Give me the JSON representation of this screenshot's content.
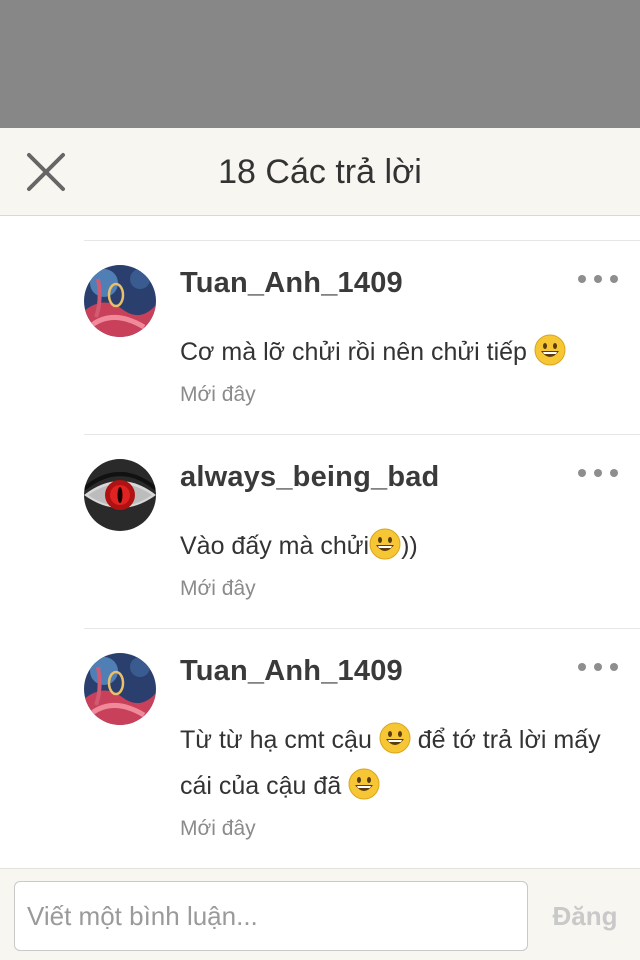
{
  "header": {
    "title": "18 Các trả lời"
  },
  "comments": [
    {
      "author": "Tuan_Anh_1409",
      "text_parts": [
        "Cơ mà lỡ chửi rồi nên chửi tiếp "
      ],
      "timestamp": "Mới đây",
      "avatar": "fantasy-art-avatar"
    },
    {
      "author": "always_being_bad",
      "text_parts": [
        "Vào đấy mà chửi",
        "))"
      ],
      "timestamp": "Mới đây",
      "avatar": "red-eye-avatar"
    },
    {
      "author": "Tuan_Anh_1409",
      "text_parts": [
        "Từ từ hạ cmt cậu ",
        " để tớ trả lời mấy cái của cậu đã "
      ],
      "timestamp": "Mới đây",
      "avatar": "fantasy-art-avatar"
    }
  ],
  "composer": {
    "placeholder": "Viết một bình luận...",
    "value": "",
    "post_label": "Đăng"
  },
  "colors": {
    "header_bg": "#f7f6f1",
    "overlay": "#878787",
    "post_disabled": "#c9c9c9",
    "emoji_yellow": "#f7c634"
  },
  "icons": [
    "close-icon",
    "more-options-icon",
    "grinning-emoji-icon"
  ]
}
